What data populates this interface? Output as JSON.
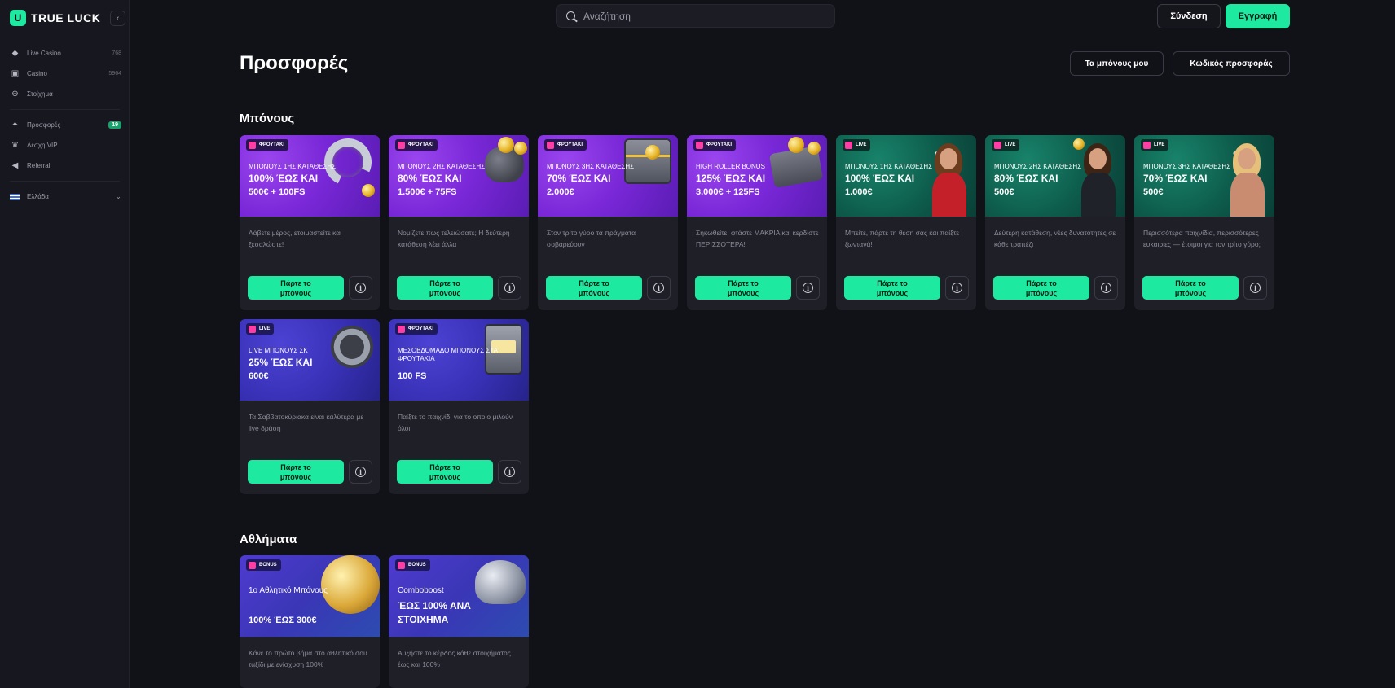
{
  "brand": {
    "name": "TRUE LUCK"
  },
  "sidebar": {
    "items": [
      {
        "label": "Live Casino",
        "count": "768"
      },
      {
        "label": "Casino",
        "count": "5964"
      },
      {
        "label": "Στοίχημα",
        "count": ""
      },
      {
        "label": "Προσφορές",
        "badge": "19"
      },
      {
        "label": "Λέσχη VIP"
      },
      {
        "label": "Referral"
      },
      {
        "label": "Ελλάδα"
      }
    ]
  },
  "header": {
    "search_placeholder": "Αναζήτηση",
    "login": "Σύνδεση",
    "register": "Εγγραφή"
  },
  "page": {
    "title": "Προσφορές",
    "my_bonuses": "Τα μπόνους μου",
    "promo_code": "Κωδικός προσφοράς"
  },
  "sections": {
    "bonus_title": "Μπόνους",
    "sports_title": "Αθλήματα"
  },
  "cta_label_1": "Πάρτε το",
  "cta_label_2": "μπόνους",
  "cards": [
    {
      "tag": "ΦΡΟΥΤΑΚΙ",
      "sub": "ΜΠΟΝΟΥΣ 1ΗΣ ΚΑΤΑΘΕΣΗΣ",
      "l1": "100% ΈΩΣ ΚΑΙ",
      "l2": "500€ + 100FS",
      "desc": "Λάβετε μέρος, ετοιμαστείτε και ξεσαλώστε!"
    },
    {
      "tag": "ΦΡΟΥΤΑΚΙ",
      "sub": "ΜΠΟΝΟΥΣ 2ΗΣ ΚΑΤΑΘΕΣΗΣ",
      "l1": "80% ΈΩΣ ΚΑΙ",
      "l2": "1.500€ + 75FS",
      "desc": "Νομίζετε πως τελειώσατε; Η δεύτερη κατάθεση λέει άλλα"
    },
    {
      "tag": "ΦΡΟΥΤΑΚΙ",
      "sub": "ΜΠΟΝΟΥΣ 3ΗΣ ΚΑΤΑΘΕΣΗΣ",
      "l1": "70% ΈΩΣ ΚΑΙ",
      "l2": "2.000€",
      "desc": "Στον τρίτο γύρο τα πράγματα σοβαρεύουν"
    },
    {
      "tag": "ΦΡΟΥΤΑΚΙ",
      "sub": "HIGH ROLLER BONUS",
      "l1": "125% ΈΩΣ ΚΑΙ",
      "l2": "3.000€ + 125FS",
      "desc": "Σηκωθείτε, φτάστε ΜΑΚΡΙΑ και κερδίστε ΠΕΡΙΣΣΟΤΕΡΑ!"
    },
    {
      "tag": "LIVE",
      "sub": "ΜΠΟΝΟΥΣ 1ΗΣ ΚΑΤΑΘΕΣΗΣ",
      "l1": "100% ΈΩΣ ΚΑΙ",
      "l2": "1.000€",
      "desc": "Μπείτε, πάρτε τη θέση σας και παίξτε ζωντανά!"
    },
    {
      "tag": "LIVE",
      "sub": "ΜΠΟΝΟΥΣ 2ΗΣ ΚΑΤΑΘΕΣΗΣ",
      "l1": "80% ΈΩΣ ΚΑΙ",
      "l2": "500€",
      "desc": "Δεύτερη κατάθεση, νέες δυνατότητες σε κάθε τραπέζι"
    },
    {
      "tag": "LIVE",
      "sub": "ΜΠΟΝΟΥΣ 3ΗΣ ΚΑΤΑΘΕΣΗΣ",
      "l1": "70% ΈΩΣ ΚΑΙ",
      "l2": "500€",
      "desc": "Περισσότερα παιχνίδια, περισσότερες ευκαιρίες — έτοιμοι για τον τρίτο γύρο;"
    },
    {
      "tag": "LIVE",
      "sub": "LIVE ΜΠΟΝΟΥΣ ΣΚ",
      "l1": "25% ΈΩΣ ΚΑΙ",
      "l2": "600€",
      "desc": "Τα Σαββατοκύριακα είναι καλύτερα με live δράση"
    },
    {
      "tag": "ΦΡΟΥΤΑΚΙ",
      "sub": "ΜΕΣΟΒΔΟΜΑΔΟ ΜΠΟΝΟΥΣ ΣΤΑ ΦΡΟΥΤΑΚΙΑ",
      "l1": "100 FS",
      "l2": "",
      "desc": "Παίξτε το παιχνίδι για το οποίο μιλούν όλοι"
    }
  ],
  "sports_cards": [
    {
      "tag": "BONUS",
      "sub": "1ο Αθλητικό Μπόνους",
      "l1": "100% ΈΩΣ 300€",
      "desc": "Κάνε το πρώτο βήμα στο αθλητικό σου ταξίδι με ενίσχυση 100%"
    },
    {
      "tag": "BONUS",
      "sub": "Comboboost",
      "l1": "ΈΩΣ 100% ΑΝΑ",
      "l2": "ΣΤΟΙΧΗΜΑ",
      "desc": "Αυξήστε το κέρδος κάθε στοιχήματος έως και 100%"
    }
  ],
  "colors": {
    "accent": "#1de9a0",
    "background": "#111118",
    "card": "#1e1f27"
  }
}
